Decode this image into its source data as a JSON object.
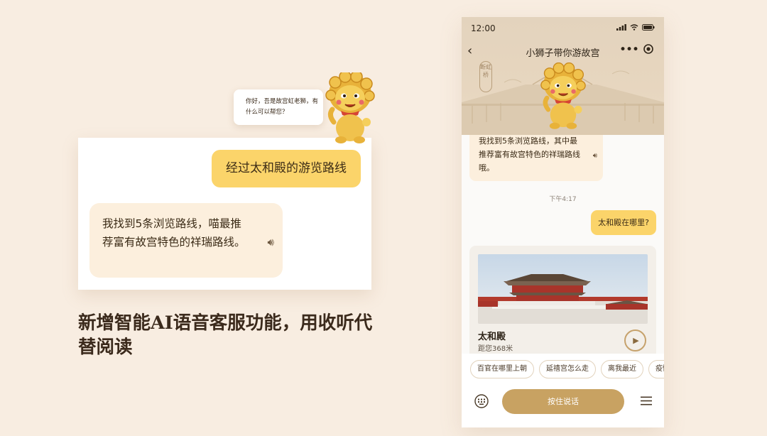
{
  "left": {
    "greeting": "你好，吾是故宫虹老狮，有什么可以帮您？",
    "user_message": "经过太和殿的游览路线",
    "bot_message": "我找到5条浏览路线，喵最推荐富有故宫特色的祥瑞路线。",
    "headline": "新增智能AI语音客服功能，用收听代替阅读"
  },
  "phone": {
    "status_time": "12:00",
    "nav_title": "小狮子带你游故宫",
    "stamp_text": "断虹桥",
    "bot_message": "我找到5条浏览路线，其中最推荐富有故宫特色的祥瑞路线哦。",
    "timestamp": "下午4:17",
    "user_message": "太和殿在哪里?",
    "place": {
      "name": "太和殿",
      "distance": "距您368米"
    },
    "chips": [
      "百官在哪里上朝",
      "延禧宫怎么走",
      "离我最近",
      "疫情"
    ],
    "talk_button": "按住说话"
  },
  "colors": {
    "background": "#f8ede1",
    "user_bubble": "#fbd46a",
    "bot_bubble": "#fcefdd",
    "accent_gold": "#c8a262"
  },
  "icons": [
    "sound-wave-icon",
    "back-arrow-icon",
    "more-dots-icon",
    "target-icon",
    "signal-icon",
    "wifi-icon",
    "battery-icon",
    "play-icon",
    "keyboard-icon",
    "menu-icon",
    "lion-mascot"
  ]
}
